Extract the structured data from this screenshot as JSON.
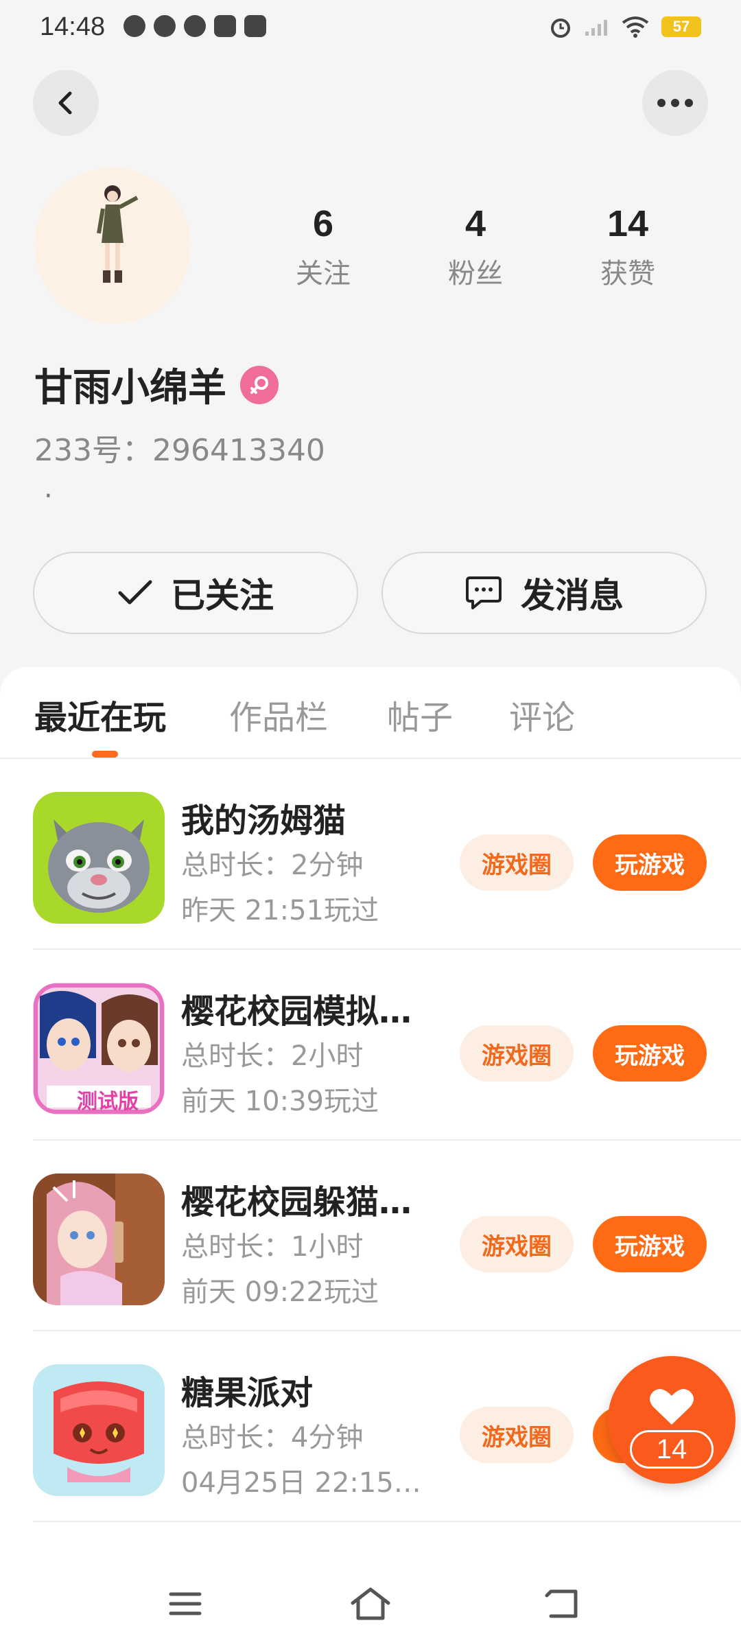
{
  "status_bar": {
    "time": "14:48",
    "battery": "57"
  },
  "header": {
    "back_icon": "chevron-left-icon",
    "more_icon": "more-dots-icon"
  },
  "profile": {
    "stats": [
      {
        "value": "6",
        "label": "关注"
      },
      {
        "value": "4",
        "label": "粉丝"
      },
      {
        "value": "14",
        "label": "获赞"
      }
    ],
    "username": "甘雨小绵羊",
    "gender": "female",
    "user_id": "233号：296413340",
    "bio": "·",
    "follow_label": "已关注",
    "message_label": "发消息"
  },
  "tabs": [
    {
      "label": "最近在玩",
      "active": true
    },
    {
      "label": "作品栏",
      "active": false
    },
    {
      "label": "帖子",
      "active": false
    },
    {
      "label": "评论",
      "active": false
    }
  ],
  "games": [
    {
      "title": "我的汤姆猫",
      "duration": "总时长：2分钟",
      "last_played": "昨天 21:51玩过",
      "circle_label": "游戏圈",
      "play_label": "玩游戏"
    },
    {
      "title": "樱花校园模拟…",
      "duration": "总时长：2小时",
      "last_played": "前天 10:39玩过",
      "circle_label": "游戏圈",
      "play_label": "玩游戏",
      "icon_badge": "测试版"
    },
    {
      "title": "樱花校园躲猫…",
      "duration": "总时长：1小时",
      "last_played": "前天 09:22玩过",
      "circle_label": "游戏圈",
      "play_label": "玩游戏"
    },
    {
      "title": "糖果派对",
      "duration": "总时长：4分钟",
      "last_played": "04月25日 22:15…",
      "circle_label": "游戏圈",
      "play_label": "玩游戏"
    }
  ],
  "floating_like": {
    "count": "14"
  },
  "colors": {
    "accent": "#ff6a14",
    "accent_light": "#fdeee3",
    "gender_pink": "#f06d99"
  }
}
